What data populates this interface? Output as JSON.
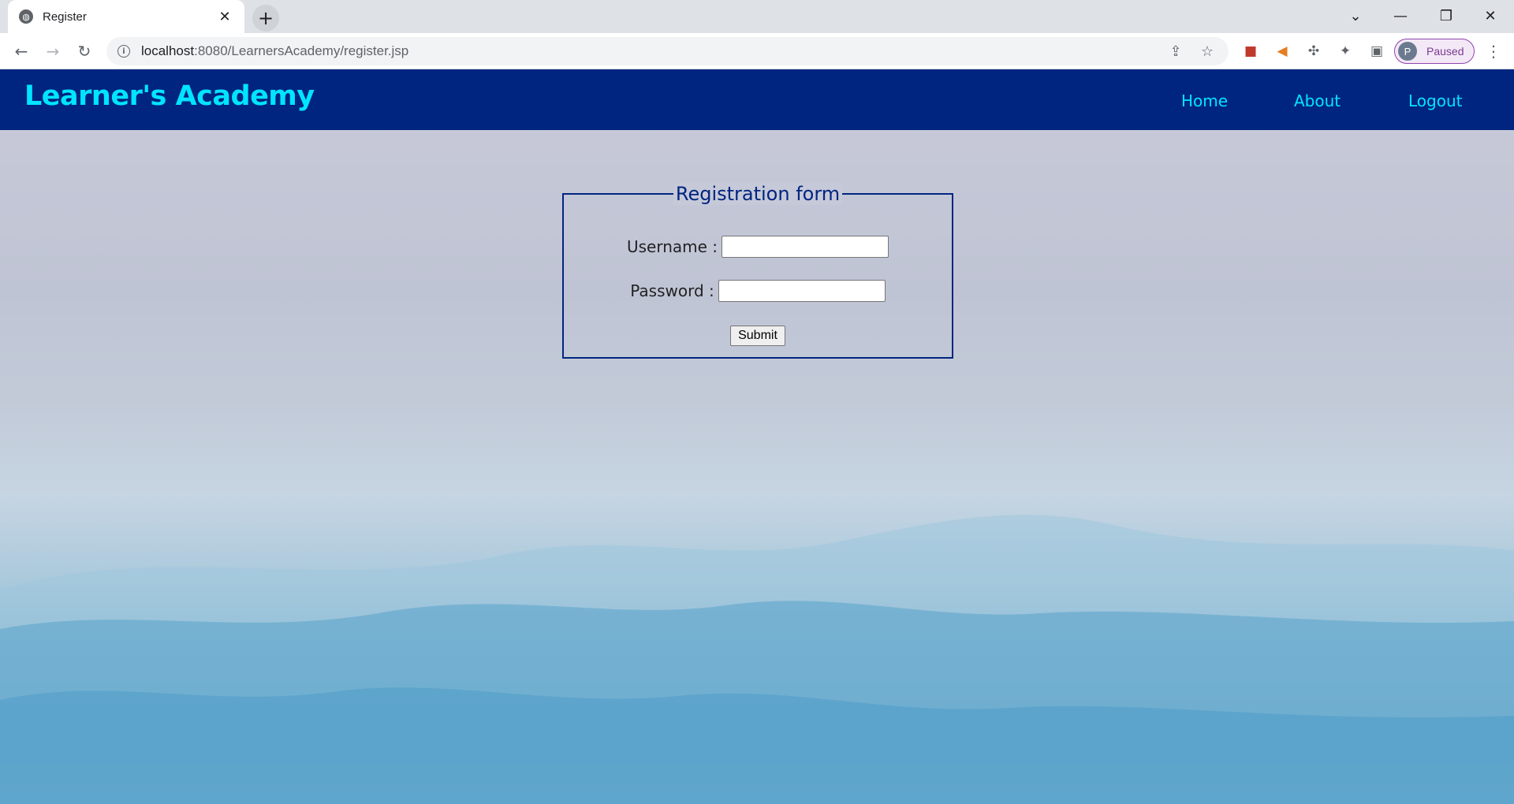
{
  "browser": {
    "tab_title": "Register",
    "url_host": "localhost",
    "url_rest": ":8080/LearnersAcademy/register.jsp",
    "profile_initial": "P",
    "profile_status": "Paused"
  },
  "site": {
    "brand": "Learner's Academy",
    "nav": {
      "home": "Home",
      "about": "About",
      "logout": "Logout"
    }
  },
  "form": {
    "legend": "Registration form",
    "username_label": "Username :",
    "password_label": "Password :",
    "username_value": "",
    "password_value": "",
    "submit_label": "Submit"
  },
  "colors": {
    "header_bg": "#002580",
    "brand_text": "#00e5ff",
    "legend_text": "#002580"
  }
}
